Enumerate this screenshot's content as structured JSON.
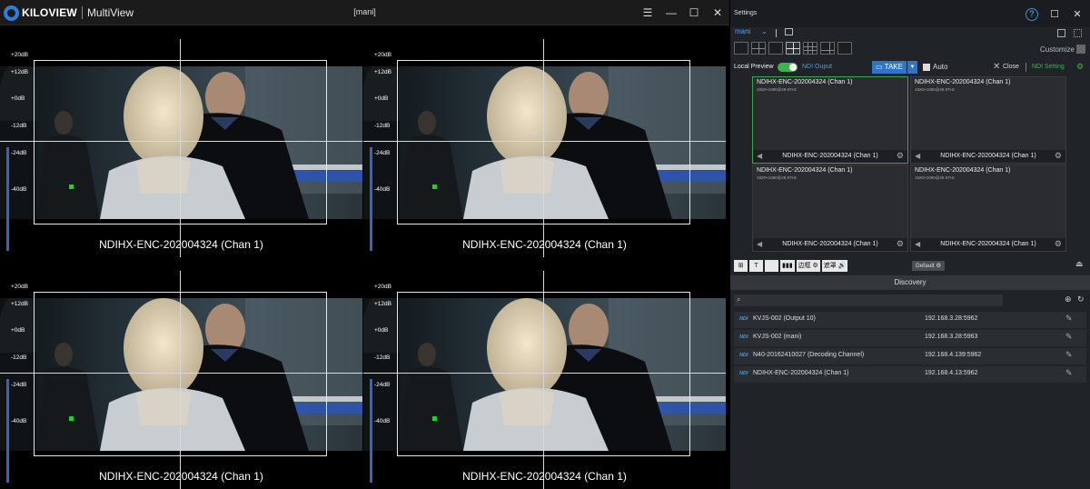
{
  "multiview": {
    "brand": "KILOVIEW",
    "app_name": "MultiView",
    "window_title": "[mani]",
    "db_scale": [
      "+20dB",
      "+12dB",
      "+0dB",
      "-12dB",
      "-24dB",
      "-40dB"
    ],
    "tiles": [
      {
        "label": "NDIHX-ENC-202004324 (Chan 1)",
        "meter_level": 1.0
      },
      {
        "label": "NDIHX-ENC-202004324 (Chan 1)",
        "meter_level": 1.0
      },
      {
        "label": "NDIHX-ENC-202004324 (Chan 1)",
        "meter_level": 1.0
      },
      {
        "label": "NDIHX-ENC-202004324 (Chan 1)",
        "meter_level": 1.0
      }
    ]
  },
  "settings": {
    "title": "Settings",
    "profile": "mani",
    "customize": "Customize",
    "local_preview": "Local Preview",
    "local_preview_on": true,
    "ndi_output": "NDI Ouput",
    "take": "TAKE",
    "auto": "Auto",
    "close": "Close",
    "ndi_setting": "NDI Setting",
    "default_label": "Default",
    "grid_cells": [
      {
        "title": "NDIHX-ENC-202004324 (Chan 1)",
        "res": "1920×1080@29.97Hz",
        "name": "NDIHX-ENC-202004324 (Chan 1)",
        "active": true
      },
      {
        "title": "NDIHX-ENC-202004324 (Chan 1)",
        "res": "1920×1080@29.97Hz",
        "name": "NDIHX-ENC-202004324 (Chan 1)",
        "active": false
      },
      {
        "title": "NDIHX-ENC-202004324 (Chan 1)",
        "res": "1920×1080@29.97Hz",
        "name": "NDIHX-ENC-202004324 (Chan 1)",
        "active": false
      },
      {
        "title": "NDIHX-ENC-202004324 (Chan 1)",
        "res": "1920×1080@29.97Hz",
        "name": "NDIHX-ENC-202004324 (Chan 1)",
        "active": false
      }
    ],
    "toolbar": [
      "T",
      "边框",
      "遮罩"
    ],
    "discovery": {
      "header": "Discovery",
      "tag": "NDI",
      "sources": [
        {
          "name": "KVJS-002 (Output 10)",
          "ip": "192.168.3.28:5962"
        },
        {
          "name": "KVJS-002 (mani)",
          "ip": "192.168.3.28:5963"
        },
        {
          "name": "N40-20162410027 (Decoding Channel)",
          "ip": "192.168.4.139:5962"
        },
        {
          "name": "NDIHX-ENC-202004324 (Chan 1)",
          "ip": "192.168.4.13:5962"
        }
      ]
    }
  }
}
